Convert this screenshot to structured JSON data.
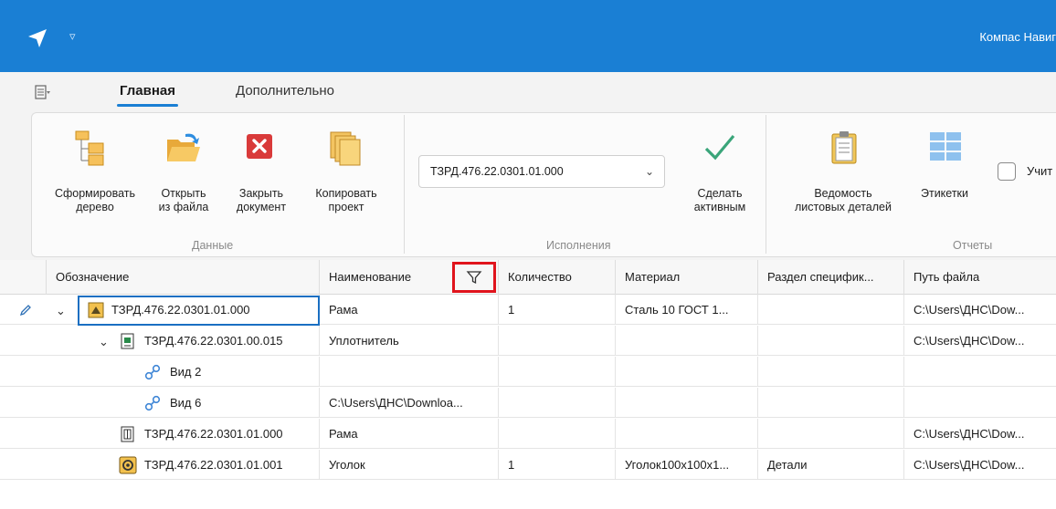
{
  "titlebar": {
    "app_title": "Компас Навиг"
  },
  "tabs": {
    "home": "Главная",
    "extra": "Дополнительно"
  },
  "ribbon": {
    "build_tree": [
      "Сформировать",
      "дерево"
    ],
    "open_file": [
      "Открыть",
      "из файла"
    ],
    "close_doc": [
      "Закрыть",
      "документ"
    ],
    "copy_project": [
      "Копировать",
      "проект"
    ],
    "group_data": "Данные",
    "variant_value": "ТЗРД.476.22.0301.01.000",
    "make_active": [
      "Сделать",
      "активным"
    ],
    "group_variants": "Исполнения",
    "sheet_list": [
      "Ведомость",
      "листовых деталей"
    ],
    "labels": "Этикетки",
    "group_reports": "Отчеты",
    "checkbox_label": "Учит"
  },
  "grid": {
    "headers": [
      "Обозначение",
      "Наименование",
      "Количество",
      "Материал",
      "Раздел специфик...",
      "Путь файла"
    ],
    "rows": [
      {
        "designation": "ТЗРД.476.22.0301.01.000",
        "name": "Рама",
        "qty": "1",
        "material": "Сталь 10  ГОСТ 1...",
        "section": "",
        "path": "C:\\Users\\ДНС\\Dow..."
      },
      {
        "designation": "ТЗРД.476.22.0301.00.015",
        "name": "Уплотнитель",
        "qty": "",
        "material": "",
        "section": "",
        "path": "C:\\Users\\ДНС\\Dow..."
      },
      {
        "designation": "Вид 2",
        "name": "",
        "qty": "",
        "material": "",
        "section": "",
        "path": ""
      },
      {
        "designation": "Вид 6",
        "name": "C:\\Users\\ДНС\\Downloa...",
        "qty": "",
        "material": "",
        "section": "",
        "path": ""
      },
      {
        "designation": "ТЗРД.476.22.0301.01.000",
        "name": "Рама",
        "qty": "",
        "material": "",
        "section": "",
        "path": "C:\\Users\\ДНС\\Dow..."
      },
      {
        "designation": "ТЗРД.476.22.0301.01.001",
        "name": "Уголок",
        "qty": "1",
        "material": "Уголок100x100x1...",
        "section": "Детали",
        "path": "C:\\Users\\ДНС\\Dow..."
      }
    ]
  },
  "icons": {
    "logo": "send-arrow-icon",
    "quick_access": "dropdown-icon",
    "filter": "filter-icon",
    "edit": "pencil-icon"
  },
  "colors": {
    "accent": "#1a7fd4",
    "highlight": "#e0141c"
  }
}
